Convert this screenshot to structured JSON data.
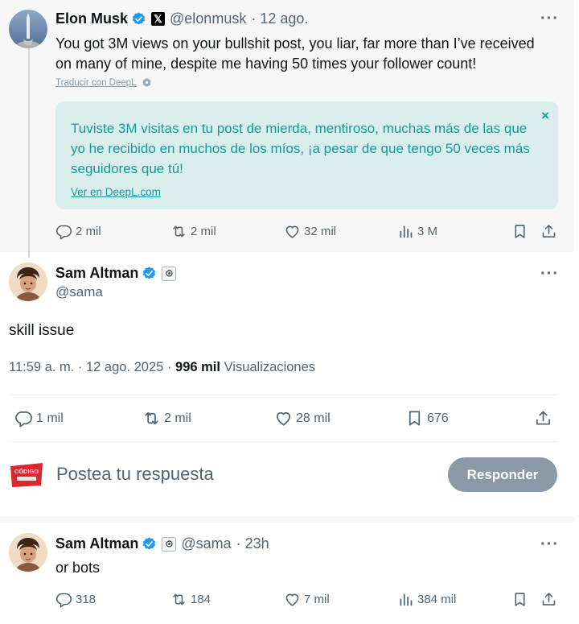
{
  "parent_tweet": {
    "author_name": "Elon Musk",
    "handle": "@elonmusk",
    "time": "· 12 ago.",
    "text": "You got 3M views on your bullshit post, you liar, far more than I’ve received on many of mine, despite me having 50 times your follower count!",
    "translate_link": "Traducir con DeepL",
    "translation": {
      "text": "Tuviste 3M visitas en tu post de mierda, mentiroso, muchas más de las que yo he recibido en muchos de los míos, ¡a pesar de que tengo 50 veces más seguidores que tú!",
      "link": "Ver en DeepL.com",
      "close": "×"
    },
    "stats": {
      "replies": "2 mil",
      "reposts": "2 mil",
      "likes": "32 mil",
      "views": "3 M"
    }
  },
  "main_tweet": {
    "author_name": "Sam Altman",
    "handle": "@sama",
    "text": "skill issue",
    "time": "11:59 a. m. · 12 ago. 2025 ·",
    "views_count": "996 mil",
    "views_label": "Visualizaciones",
    "stats": {
      "replies": "1 mil",
      "reposts": "2 mil",
      "likes": "28 mil",
      "bookmarks": "676"
    }
  },
  "reply_composer": {
    "placeholder": "Postea tu respuesta",
    "button": "Responder",
    "avatar_text": "CÓDIGO"
  },
  "reply_tweet": {
    "author_name": "Sam Altman",
    "handle": "@sama",
    "time": "· 23h",
    "text": "or bots",
    "stats": {
      "replies": "318",
      "reposts": "184",
      "likes": "7 mil",
      "views": "384 mil"
    }
  },
  "more_glyph": "···",
  "x_logo_glyph": "𝕏",
  "colors": {
    "verified": "#1d9bf0",
    "deepl_text": "#139a9a",
    "deepl_bg": "#dbeeee",
    "reply_button": "#8b98a5"
  }
}
